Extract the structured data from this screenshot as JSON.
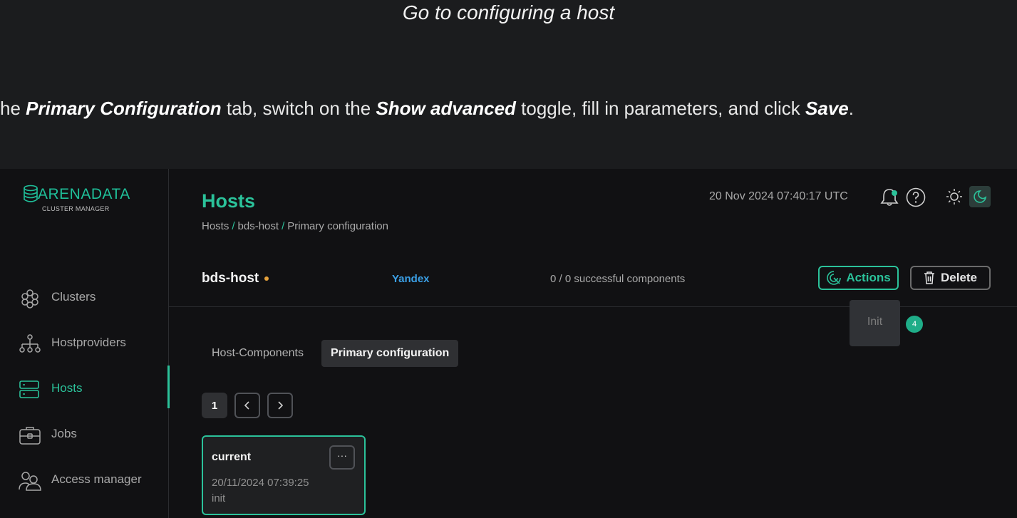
{
  "captions": {
    "top": "Go to configuring a host",
    "instruction": {
      "p1": "he ",
      "b1": "Primary Configuration",
      "p2": " tab, switch on the ",
      "b2": "Show advanced",
      "p3": " toggle, fill in parameters, and click ",
      "b3": "Save",
      "p4": "."
    }
  },
  "logo": {
    "word": "ARENADATA",
    "sub": "CLUSTER MANAGER"
  },
  "sidebar": {
    "items": [
      {
        "label": "Clusters",
        "icon": "clusters-icon",
        "active": false
      },
      {
        "label": "Hostproviders",
        "icon": "hostproviders-icon",
        "active": false
      },
      {
        "label": "Hosts",
        "icon": "hosts-icon",
        "active": true
      },
      {
        "label": "Jobs",
        "icon": "jobs-icon",
        "active": false
      },
      {
        "label": "Access manager",
        "icon": "access-manager-icon",
        "active": false
      }
    ]
  },
  "header": {
    "title": "Hosts",
    "breadcrumb": [
      "Hosts",
      "bds-host",
      "Primary configuration"
    ],
    "breadcrumb_sep": "/",
    "datetime": "20 Nov 2024  07:40:17  UTC"
  },
  "host": {
    "name": "bds-host",
    "provider": "Yandex",
    "components": "0 / 0 successful components"
  },
  "actions": {
    "actions_label": "Actions",
    "delete_label": "Delete",
    "dropdown_items": [
      "Init"
    ],
    "step_badge": "4"
  },
  "tabs": [
    {
      "label": "Host-Components",
      "active": false
    },
    {
      "label": "Primary configuration",
      "active": true
    }
  ],
  "pagination": {
    "current": "1"
  },
  "config_card": {
    "title": "current",
    "date": "20/11/2024 07:39:25",
    "description": "init",
    "menu": "···"
  },
  "colors": {
    "accent": "#2bc29a",
    "background": "#111113",
    "provider_link": "#3ba0e6",
    "status_dot": "#e6a23c"
  }
}
